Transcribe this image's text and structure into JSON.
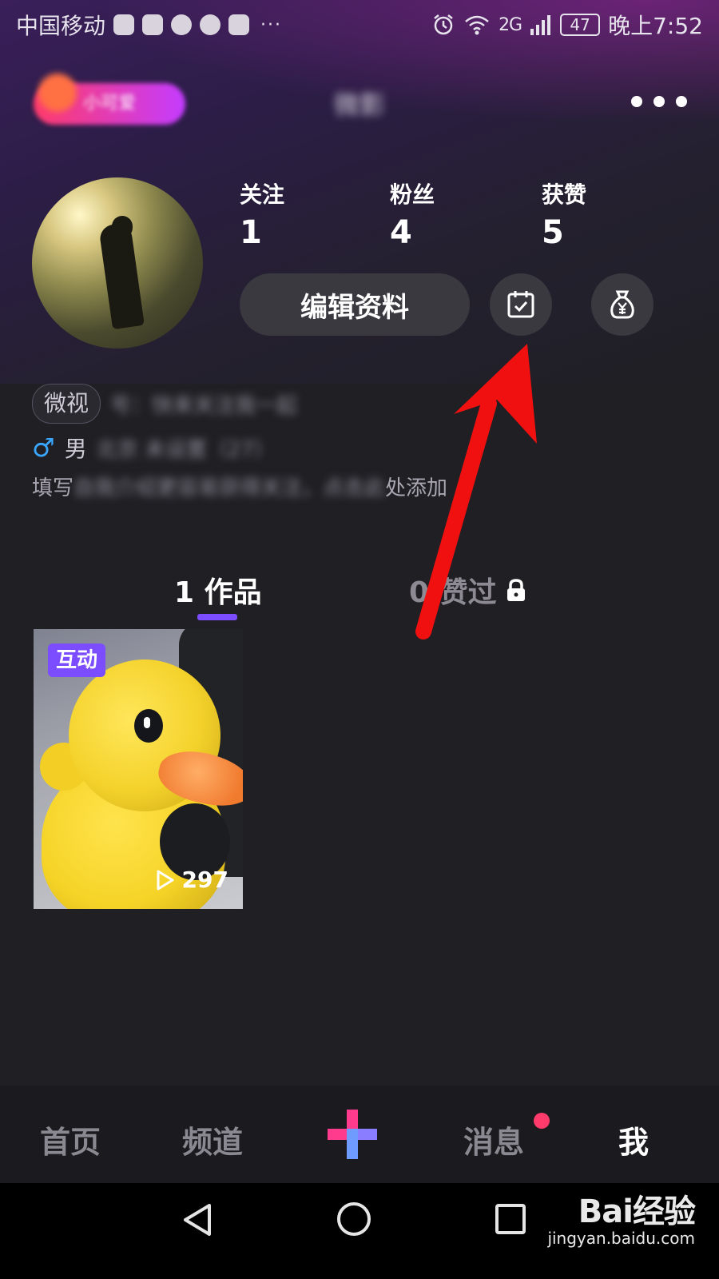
{
  "status_bar": {
    "carrier": "中国移动",
    "dots": "···",
    "network": "2G",
    "battery": "47",
    "time": "晚上7:52"
  },
  "header": {
    "badge_text": "小可爱",
    "title": "微影",
    "more_icon": "more-dots-icon"
  },
  "profile": {
    "stats": [
      {
        "label": "关注",
        "value": "1"
      },
      {
        "label": "粉丝",
        "value": "4"
      },
      {
        "label": "获赞",
        "value": "5"
      }
    ],
    "edit_label": "编辑资料",
    "checkin_icon": "calendar-check-icon",
    "wallet_icon": "money-bag-icon",
    "source_tag": "微视",
    "source_blur": "号：快来关注我一起",
    "gender_icon": "♂",
    "gender": "男",
    "gender_blur": "北京 未设置（27）",
    "bio_prefix": "填写",
    "bio_blur": "自我介绍更容易获得关注，点击此",
    "bio_suffix": "处添加"
  },
  "tabs": {
    "works": "1 作品",
    "liked": "0 赞过",
    "lock_icon": "lock-icon"
  },
  "works": [
    {
      "tag": "互动",
      "plays": "297",
      "play_icon": "play-icon"
    }
  ],
  "tabbar": {
    "home": "首页",
    "channel": "频道",
    "add_icon": "plus-icon",
    "messages": "消息",
    "me": "我"
  },
  "system_nav": {
    "back_icon": "back-triangle-icon",
    "home_icon": "home-circle-icon",
    "recents_icon": "recents-square-icon"
  },
  "watermark": {
    "brand": "Bai经验",
    "url": "jingyan.baidu.com"
  },
  "colors": {
    "accent": "#7b4dff",
    "notification": "#ff3b6b",
    "annotation": "#f01010"
  }
}
